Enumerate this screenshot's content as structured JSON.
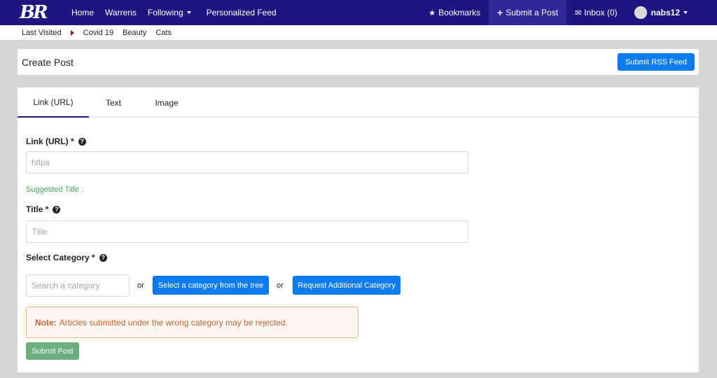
{
  "brand": {
    "logo_text": "BR"
  },
  "nav": {
    "home": "Home",
    "warrens": "Warrens",
    "following": "Following",
    "personalized_feed": "Personalized Feed",
    "bookmarks": "Bookmarks",
    "submit_post": "Submit a Post",
    "inbox": "Inbox (0)",
    "username": "nabs12"
  },
  "breadcrumbs": {
    "last_visited": "Last Visited",
    "items": [
      "Covid 19",
      "Beauty",
      "Cats"
    ]
  },
  "header": {
    "title": "Create Post",
    "rss_button": "Submit RSS Feed"
  },
  "tabs": [
    "Link (URL)",
    "Text",
    "Image"
  ],
  "form": {
    "link_label": "Link (URL) *",
    "link_placeholder": "https",
    "suggested_title": "Suggested Title :",
    "title_label": "Title *",
    "title_placeholder": "Title",
    "category_label": "Select Category *",
    "category_placeholder": "Search a category",
    "or_text": "or",
    "tree_button": "Select a category from the tree",
    "request_button": "Request Additional Category",
    "note_label": "Note:",
    "note_text": "Articles submitted under the wrong category may be rejected.",
    "submit_button": "Submit Post"
  },
  "colors": {
    "navbar": "#1d1580",
    "primary_button": "#0d7cf2",
    "submit_button": "#6cae7d",
    "suggested_text": "#3fa65d",
    "note_text": "#c0622c"
  }
}
